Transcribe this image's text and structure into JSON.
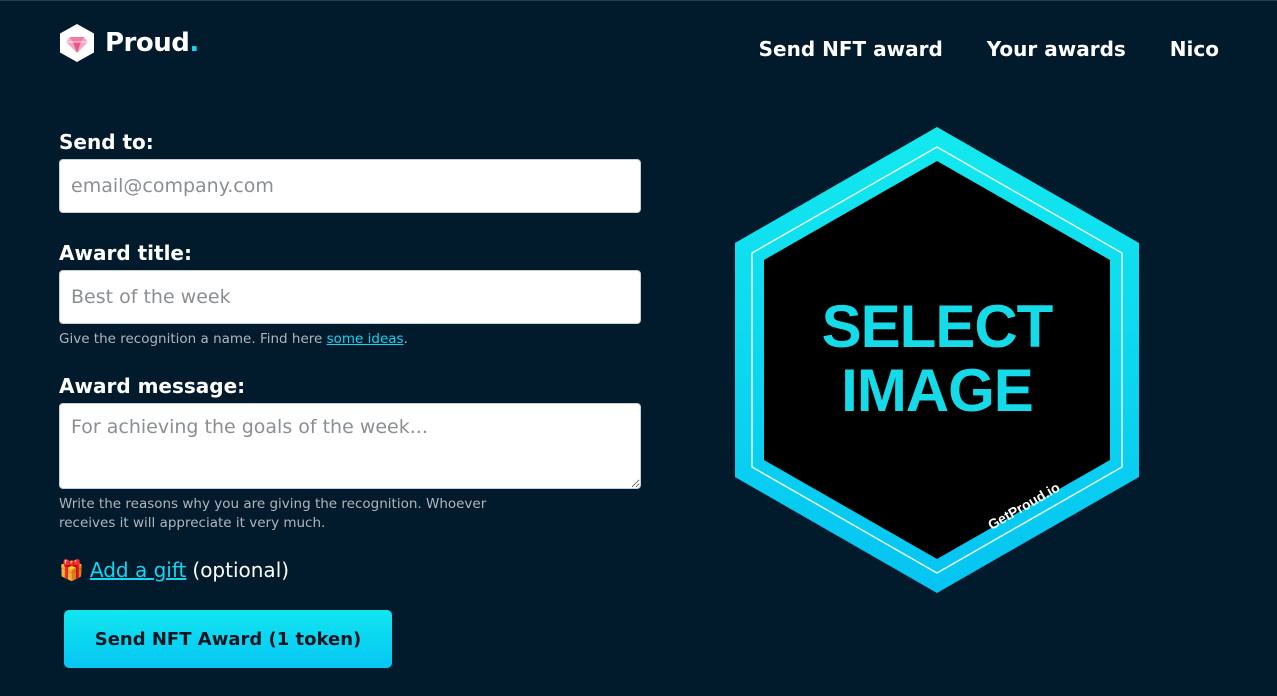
{
  "header": {
    "logo_text": "Proud",
    "logo_dot": ".",
    "nav": {
      "send_award": "Send NFT award",
      "your_awards": "Your awards",
      "user": "Nico"
    }
  },
  "form": {
    "send_to": {
      "label": "Send to:",
      "placeholder": "email@company.com",
      "value": ""
    },
    "award_title": {
      "label": "Award title:",
      "placeholder": "Best of the week",
      "value": "",
      "help_prefix": "Give the recognition a name. Find here ",
      "help_link": "some ideas",
      "help_suffix": "."
    },
    "award_message": {
      "label": "Award message:",
      "placeholder": "For achieving the goals of the week...",
      "value": "",
      "help_line1": "Write the reasons why you are giving the recognition. Whoever",
      "help_line2": "receives it will appreciate it very much."
    },
    "gift": {
      "icon": "gift-icon",
      "icon_glyph": "🎁",
      "link": "Add a gift",
      "suffix": "(optional)"
    },
    "submit_label": "Send NFT Award (1 token)"
  },
  "image_selector": {
    "line1": "SELECT",
    "line2": "IMAGE",
    "brand": "GetProud.io"
  },
  "colors": {
    "background": "#011a2c",
    "accent": "#12d6f2",
    "hex_fill": "#000000"
  }
}
